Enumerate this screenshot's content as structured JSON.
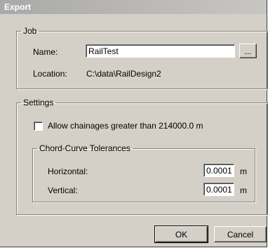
{
  "window": {
    "title": "Export"
  },
  "job": {
    "legend": "Job",
    "name_label": "Name:",
    "name_value": "RailTest",
    "browse_label": "...",
    "location_label": "Location:",
    "location_value": "C:\\data\\RailDesign2"
  },
  "settings": {
    "legend": "Settings",
    "allow_chainages_label": "Allow chainages greater than 214000.0 m",
    "allow_chainages_checked": false,
    "tolerances": {
      "legend": "Chord-Curve Tolerances",
      "horizontal_label": "Horizontal:",
      "horizontal_value": "0.0001",
      "horizontal_unit": "m",
      "vertical_label": "Vertical:",
      "vertical_value": "0.0001",
      "vertical_unit": "m"
    }
  },
  "buttons": {
    "ok": "OK",
    "cancel": "Cancel"
  }
}
